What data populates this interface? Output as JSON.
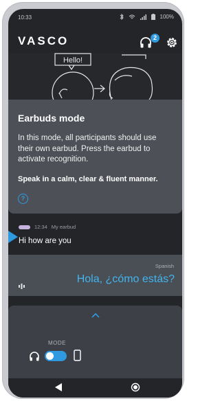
{
  "status_bar": {
    "time": "10:33",
    "battery": "100%",
    "icons": [
      "bluetooth-icon",
      "wifi-icon",
      "signal-icon",
      "battery-icon"
    ]
  },
  "header": {
    "logo": "VASCO",
    "notification_count": "2"
  },
  "illustration": {
    "speech_label": "Hello!"
  },
  "modal": {
    "title": "Earbuds mode",
    "body": "In this mode, all participants should use their own earbud. Press the earbud to activate recognition.",
    "emphasis": "Speak in a calm, clear & fluent manner.",
    "help": "?"
  },
  "message": {
    "time": "12:34",
    "source": "My earbud",
    "text": "Hi how are you"
  },
  "translation": {
    "language": "Spanish",
    "text": "Hola, ¿cómo estás?"
  },
  "mode_panel": {
    "label": "MODE"
  },
  "colors": {
    "accent": "#2f9ae0",
    "translation_text": "#42b4ee",
    "background": "#232529",
    "modal": "#4d5157"
  }
}
